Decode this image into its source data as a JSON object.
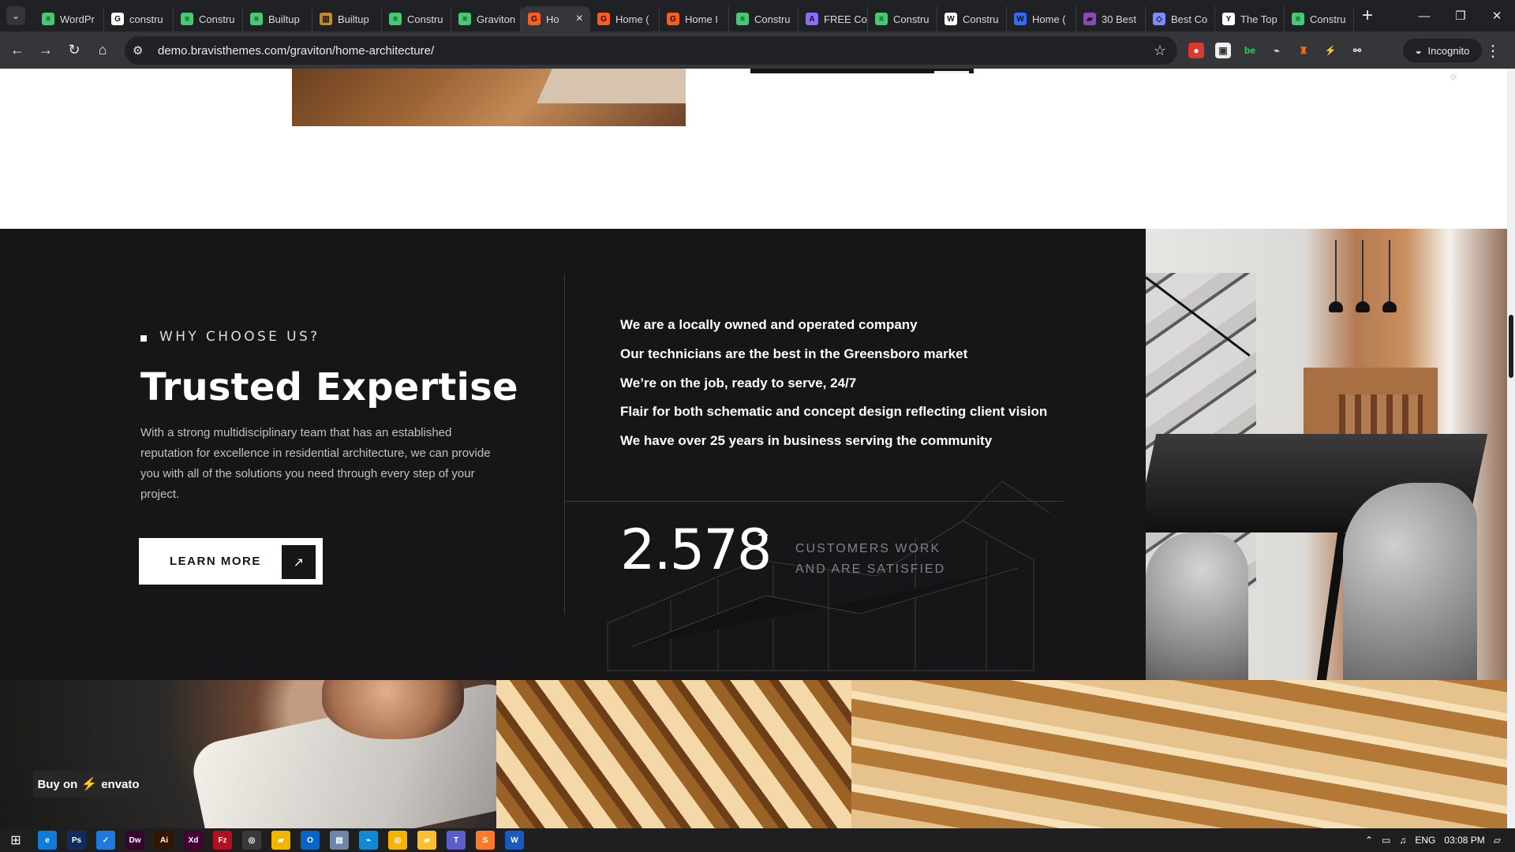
{
  "browser": {
    "tabs": [
      {
        "title": "WordPr",
        "favicon": "page-favicon",
        "color": "#48c774",
        "glyph": "≡"
      },
      {
        "title": "constru",
        "favicon": "google-icon",
        "color": "#ffffff",
        "glyph": "G"
      },
      {
        "title": "Constru",
        "favicon": "page-favicon",
        "color": "#48c774",
        "glyph": "≡"
      },
      {
        "title": "Builtup",
        "favicon": "page-favicon",
        "color": "#48c774",
        "glyph": "≡"
      },
      {
        "title": "Builtup",
        "favicon": "page-favicon",
        "color": "#c18a2d",
        "glyph": "▥"
      },
      {
        "title": "Constru",
        "favicon": "page-favicon",
        "color": "#48c774",
        "glyph": "≡"
      },
      {
        "title": "Graviton",
        "favicon": "page-favicon",
        "color": "#48c774",
        "glyph": "≡"
      },
      {
        "title": "Ho",
        "favicon": "graviton-icon",
        "color": "#ff5a1f",
        "glyph": "G",
        "active": true
      },
      {
        "title": "Home (",
        "favicon": "graviton-icon",
        "color": "#ff5a1f",
        "glyph": "G"
      },
      {
        "title": "Home I",
        "favicon": "graviton-icon",
        "color": "#ff5a1f",
        "glyph": "G"
      },
      {
        "title": "Constru",
        "favicon": "page-favicon",
        "color": "#48c774",
        "glyph": "≡"
      },
      {
        "title": "FREE Co",
        "favicon": "page-favicon",
        "color": "#8e6bff",
        "glyph": "A"
      },
      {
        "title": "Constru",
        "favicon": "page-favicon",
        "color": "#48c774",
        "glyph": "≡"
      },
      {
        "title": "Constru",
        "favicon": "wix-icon",
        "color": "#ffffff",
        "glyph": "W"
      },
      {
        "title": "Home (",
        "favicon": "page-favicon",
        "color": "#2d6cff",
        "glyph": "W"
      },
      {
        "title": "30 Best",
        "favicon": "page-favicon",
        "color": "#8a4bb8",
        "glyph": "▰"
      },
      {
        "title": "Best Co",
        "favicon": "page-favicon",
        "color": "#7b8dff",
        "glyph": "◇"
      },
      {
        "title": "The Top",
        "favicon": "yahoo-icon",
        "color": "#ffffff",
        "glyph": "Y"
      },
      {
        "title": "Constru",
        "favicon": "page-favicon",
        "color": "#48c774",
        "glyph": "≡"
      }
    ],
    "url": "demo.bravisthemes.com/graviton/home-architecture/",
    "incognito_label": "Incognito",
    "new_tab": "+"
  },
  "page": {
    "kicker": "WHY CHOOSE US?",
    "heading": "Trusted Expertise",
    "body": "With a strong multidisciplinary team that has an established reputation for excellence in residential architecture, we can provide you with all of the solutions you need through every step of your project.",
    "button": "LEARN MORE",
    "features": [
      "We are a locally owned and operated company",
      "Our technicians are the best in the Greensboro market",
      "We’re on the job, ready to serve, 24/7",
      "Flair for both schematic and concept design reflecting client vision",
      "We have over 25 years in business serving the community"
    ],
    "stat_value": "2.578",
    "stat_plus": "+",
    "stat_label_1": "CUSTOMERS WORK",
    "stat_label_2": "AND ARE SATISFIED",
    "buy_label": "Buy on",
    "envato_label": "envato"
  },
  "taskbar": {
    "language": "ENG",
    "time": "03:08 PM",
    "apps": [
      {
        "name": "edge-icon",
        "label": "e",
        "color": "#0f7dd8"
      },
      {
        "name": "photoshop-icon",
        "label": "Ps",
        "color": "#0f2d58"
      },
      {
        "name": "todo-icon",
        "label": "✓",
        "color": "#1f7ae0"
      },
      {
        "name": "dreamweaver-icon",
        "label": "Dw",
        "color": "#350531"
      },
      {
        "name": "illustrator-icon",
        "label": "Ai",
        "color": "#331400"
      },
      {
        "name": "xd-icon",
        "label": "Xd",
        "color": "#450135"
      },
      {
        "name": "filezilla-icon",
        "label": "Fz",
        "color": "#b2101f"
      },
      {
        "name": "chrome-icon",
        "label": "◎",
        "color": "#3a3a3a"
      },
      {
        "name": "notes-icon",
        "label": "▰",
        "color": "#f2b600"
      },
      {
        "name": "outlook-icon",
        "label": "O",
        "color": "#0a64c6"
      },
      {
        "name": "notepad-icon",
        "label": "▤",
        "color": "#6e86a7"
      },
      {
        "name": "vscode-icon",
        "label": "⌁",
        "color": "#1188d6"
      },
      {
        "name": "chrome-icon-2",
        "label": "◎",
        "color": "#f4b400"
      },
      {
        "name": "folder-icon",
        "label": "▰",
        "color": "#ffbf2f"
      },
      {
        "name": "teams-icon",
        "label": "T",
        "color": "#5b5fc7"
      },
      {
        "name": "sublime-icon",
        "label": "S",
        "color": "#ff7a29"
      },
      {
        "name": "word-icon",
        "label": "W",
        "color": "#185abd"
      }
    ]
  }
}
